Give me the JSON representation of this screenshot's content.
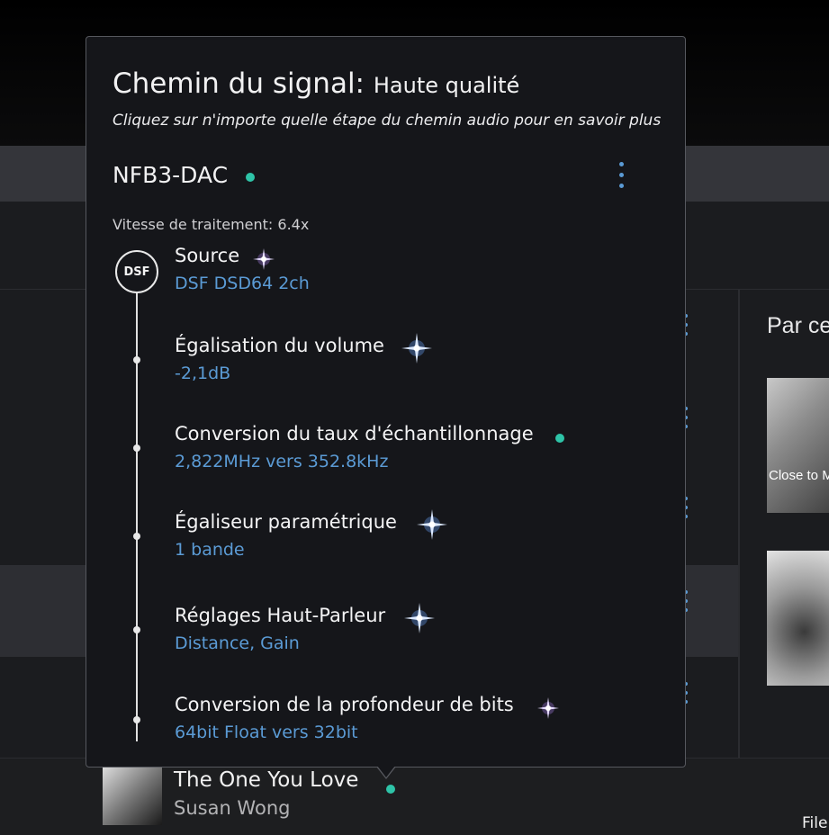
{
  "popup": {
    "title": "Chemin du signal:",
    "quality": "Haute qualité",
    "subtitle": "Cliquez sur n'importe quelle étape du chemin audio pour en savoir plus",
    "device": "NFB3-DAC",
    "speed": "Vitesse de traitement: 6.4x",
    "source_badge": "DSF",
    "steps": [
      {
        "name": "Source",
        "value": "DSF DSD64 2ch",
        "indicator": "purple-sparkle-icon"
      },
      {
        "name": "Égalisation du volume",
        "value": "-2,1dB",
        "indicator": "blue-sparkle-icon"
      },
      {
        "name": "Conversion du taux d'échantillonnage",
        "value": "2,822MHz vers 352.8kHz",
        "indicator": "teal-dot-icon"
      },
      {
        "name": "Égaliseur paramétrique",
        "value": "1 bande",
        "indicator": "blue-sparkle-icon"
      },
      {
        "name": "Réglages Haut-Parleur",
        "value": "Distance, Gain",
        "indicator": "blue-sparkle-icon"
      },
      {
        "name": "Conversion de la profondeur de bits",
        "value": "64bit Float vers 32bit",
        "indicator": "purple-sparkle-icon"
      }
    ]
  },
  "right_panel": {
    "title": "Par ce",
    "album1_caption": "Close to M"
  },
  "player": {
    "title": "The One You Love",
    "artist": "Susan Wong",
    "file_label": "File"
  },
  "colors": {
    "accent_blue": "#5b9bd5",
    "teal": "#2ec4a8",
    "popup_bg": "#15161a"
  }
}
